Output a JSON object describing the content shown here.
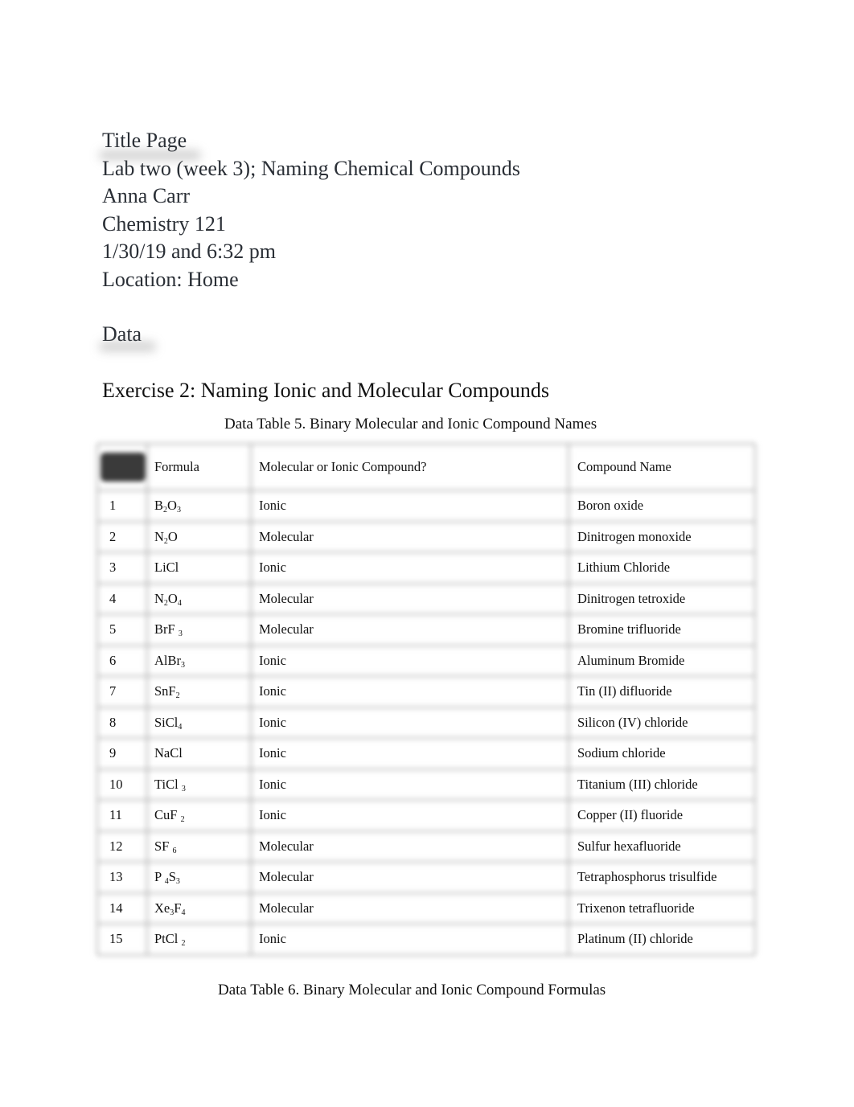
{
  "title_page": {
    "heading": "Title Page",
    "lines": [
      "Lab two (week 3); Naming Chemical Compounds",
      "Anna Carr",
      "Chemistry 121",
      "1/30/19 and 6:32 pm",
      "Location: Home"
    ]
  },
  "data_section": {
    "heading": "Data"
  },
  "exercise": {
    "heading": "Exercise 2: Naming Ionic and Molecular Compounds"
  },
  "table5": {
    "caption": "Data Table 5.  Binary Molecular and Ionic Compound Names",
    "headers": [
      "",
      "Formula",
      "Molecular or Ionic Compound?",
      "Compound Name"
    ],
    "rows": [
      {
        "num": "1",
        "formula": [
          [
            "B",
            "2"
          ],
          [
            "O",
            "3"
          ]
        ],
        "type": "Ionic",
        "name": "Boron oxide"
      },
      {
        "num": "2",
        "formula": [
          [
            "N",
            "2"
          ],
          [
            "O",
            ""
          ]
        ],
        "type": "Molecular",
        "name": "Dinitrogen monoxide"
      },
      {
        "num": "3",
        "formula": [
          [
            "LiCl",
            ""
          ]
        ],
        "type": "Ionic",
        "name": "Lithium Chloride"
      },
      {
        "num": "4",
        "formula": [
          [
            "N",
            "2"
          ],
          [
            "O",
            "4"
          ]
        ],
        "type": "Molecular",
        "name": "Dinitrogen tetroxide"
      },
      {
        "num": "5",
        "formula": [
          [
            "BrF ",
            "3"
          ]
        ],
        "type": "Molecular",
        "name": "Bromine trifluoride"
      },
      {
        "num": "6",
        "formula": [
          [
            "AlBr",
            "3"
          ]
        ],
        "type": "Ionic",
        "name": "Aluminum Bromide"
      },
      {
        "num": "7",
        "formula": [
          [
            "SnF",
            "2"
          ]
        ],
        "type": "Ionic",
        "name": "Tin (II) difluoride"
      },
      {
        "num": "8",
        "formula": [
          [
            "SiCl",
            "4"
          ]
        ],
        "type": "Ionic",
        "name": "Silicon (IV) chloride"
      },
      {
        "num": "9",
        "formula": [
          [
            "NaCl",
            ""
          ]
        ],
        "type": "Ionic",
        "name": "Sodium chloride"
      },
      {
        "num": "10",
        "formula": [
          [
            "TiCl ",
            "3"
          ]
        ],
        "type": "Ionic",
        "name": "Titanium (III) chloride"
      },
      {
        "num": "11",
        "formula": [
          [
            "CuF ",
            "2"
          ]
        ],
        "type": "Ionic",
        "name": "Copper (II) fluoride"
      },
      {
        "num": "12",
        "formula": [
          [
            "SF ",
            "6"
          ]
        ],
        "type": "Molecular",
        "name": "Sulfur hexafluoride"
      },
      {
        "num": "13",
        "formula": [
          [
            "P ",
            "4"
          ],
          [
            "S",
            "3"
          ]
        ],
        "type": "Molecular",
        "name": "Tetraphosphorus trisulfide"
      },
      {
        "num": "14",
        "formula": [
          [
            "Xe",
            "3"
          ],
          [
            "F",
            "4"
          ]
        ],
        "type": "Molecular",
        "name": "Trixenon tetrafluoride"
      },
      {
        "num": "15",
        "formula": [
          [
            "PtCl ",
            "2"
          ]
        ],
        "type": "Ionic",
        "name": "Platinum (II) chloride"
      }
    ]
  },
  "table6": {
    "caption": "Data Table 6.  Binary Molecular and Ionic Compound Formulas"
  }
}
